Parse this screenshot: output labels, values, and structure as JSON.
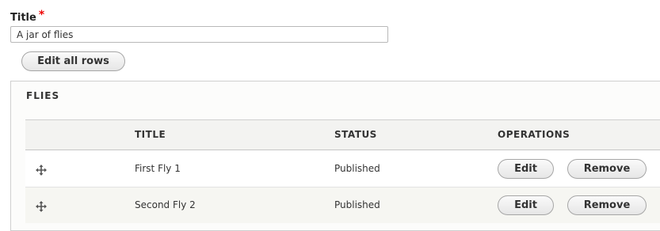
{
  "title_field": {
    "label": "Title",
    "required_marker": "*",
    "value": "A jar of flies"
  },
  "edit_all_label": "Edit all rows",
  "fieldset": {
    "legend": "FLIES",
    "columns": [
      "TITLE",
      "STATUS",
      "OPERATIONS"
    ],
    "rows": [
      {
        "title": "First Fly 1",
        "status": "Published",
        "edit": "Edit",
        "remove": "Remove"
      },
      {
        "title": "Second Fly 2",
        "status": "Published",
        "edit": "Edit",
        "remove": "Remove"
      }
    ]
  },
  "icons": {
    "drag_handle": "move-arrows-icon"
  },
  "colors": {
    "required": "#ee0000",
    "header_bg": "#f3f3f1",
    "alt_row_bg": "#f6f6f2"
  }
}
